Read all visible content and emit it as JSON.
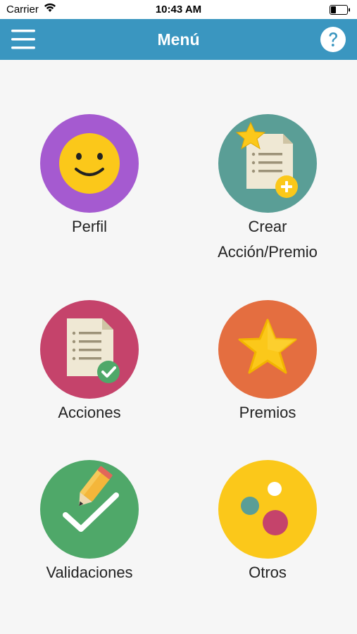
{
  "status_bar": {
    "carrier": "Carrier",
    "time": "10:43 AM",
    "wifi_icon": "wifi-icon",
    "battery_icon": "battery-icon"
  },
  "nav_bar": {
    "title": "Menú",
    "menu_icon": "hamburger-menu-icon",
    "help_icon": "question-mark-icon",
    "background": "#3a96c0"
  },
  "menu": {
    "perfil": {
      "label": "Perfil",
      "color": "#a55ad0",
      "icon": "smiley-face-icon"
    },
    "crear": {
      "label_line1": "Crear",
      "label_line2": "Acción/Premio",
      "color": "#5a9e96",
      "icon": "document-star-add-icon"
    },
    "acciones": {
      "label": "Acciones",
      "color": "#c5436b",
      "icon": "document-check-icon"
    },
    "premios": {
      "label": "Premios",
      "color": "#e46e40",
      "icon": "star-icon"
    },
    "validaciones": {
      "label": "Validaciones",
      "color": "#4fa869",
      "icon": "pencil-check-icon"
    },
    "otros": {
      "label": "Otros",
      "color": "#fbc81a",
      "icon": "dots-icon"
    }
  }
}
